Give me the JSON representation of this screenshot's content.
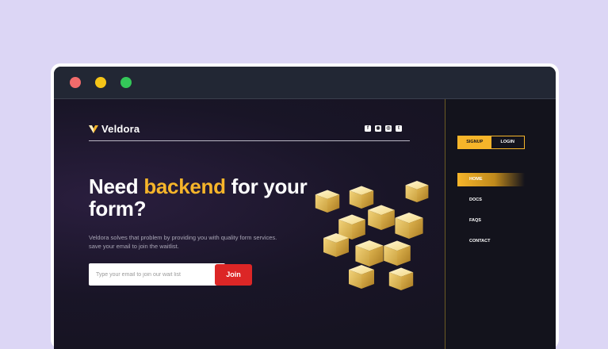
{
  "window": {
    "traffic_lights": [
      "close",
      "minimize",
      "maximize"
    ],
    "colors": {
      "close": "#f26b6b",
      "minimize": "#f5c518",
      "maximize": "#34c759"
    }
  },
  "brand": {
    "name": "Veldora",
    "accent_color": "#f6b52a"
  },
  "social": [
    {
      "icon": "facebook-icon",
      "glyph": "f"
    },
    {
      "icon": "github-icon",
      "glyph": "◉"
    },
    {
      "icon": "instagram-icon",
      "glyph": "◎"
    },
    {
      "icon": "twitter-icon",
      "glyph": "t"
    }
  ],
  "hero": {
    "headline_pre": "Need ",
    "headline_accent": "backend",
    "headline_post": " for your form?",
    "description_line1": "Veldora solves that problem by providing you with quality form services.",
    "description_line2": "save your email to join the waitlist."
  },
  "form": {
    "email_placeholder": "Type your email to join our wait list",
    "email_value": "",
    "join_label": "Join",
    "join_color": "#dc2626"
  },
  "sidebar": {
    "signup_label": "SIGNUP",
    "login_label": "LOGIN",
    "nav": [
      {
        "label": "HOME",
        "active": true
      },
      {
        "label": "DOCS",
        "active": false
      },
      {
        "label": "FAQS",
        "active": false
      },
      {
        "label": "CONTACT",
        "active": false
      }
    ]
  }
}
